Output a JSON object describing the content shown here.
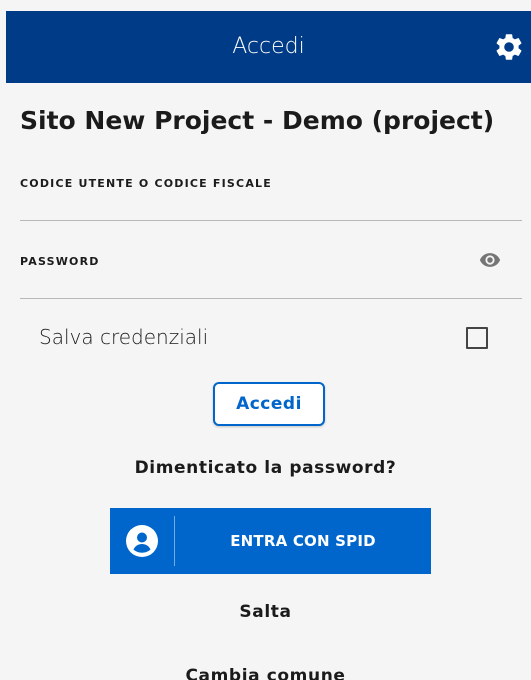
{
  "header": {
    "title": "Accedi",
    "settings_icon": "gear-icon",
    "background_color": "#003b87"
  },
  "site": {
    "title": "Sito New Project - Demo (project)"
  },
  "form": {
    "username": {
      "label": "CODICE UTENTE O CODICE FISCALE",
      "value": ""
    },
    "password": {
      "label": "PASSWORD",
      "value": "",
      "toggle_icon": "eye-icon"
    },
    "remember": {
      "label": "Salva credenziali",
      "checked": false
    },
    "submit_label": "Accedi"
  },
  "links": {
    "forgot_password": "Dimenticato la password?",
    "skip": "Salta",
    "change_municipality": "Cambia comune"
  },
  "spid": {
    "label": "ENTRA CON SPID",
    "icon": "user-circle-icon",
    "color": "#0066cc"
  }
}
